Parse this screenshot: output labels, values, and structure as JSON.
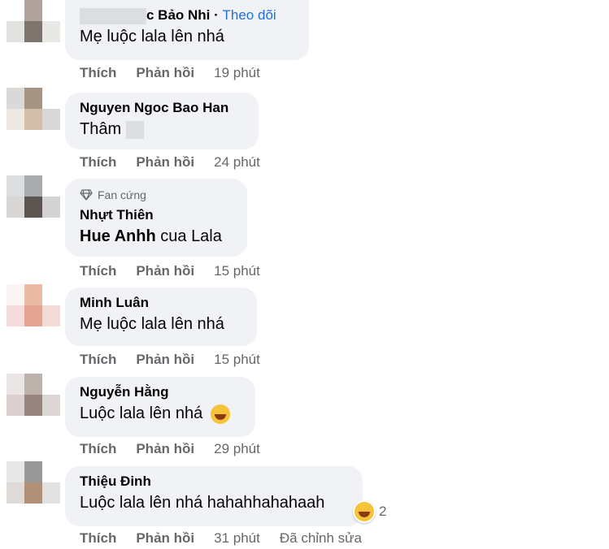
{
  "comments": [
    {
      "name": "c Bảo Nhi",
      "follow": "Theo dõi",
      "text": "Mẹ luộc lala lên nhá",
      "like": "Thích",
      "reply": "Phản hồi",
      "time": "19 phút"
    },
    {
      "name": "Nguyen Ngoc Bao Han",
      "text": "Thâm",
      "like": "Thích",
      "reply": "Phản hồi",
      "time": "24 phút"
    },
    {
      "badge": "Fan cứng",
      "name": "Nhựt Thiên",
      "mention": "Hue Anhh",
      "text": " cua Lala",
      "like": "Thích",
      "reply": "Phản hồi",
      "time": "15 phút"
    },
    {
      "name": "Minh Luân",
      "text": "Mẹ luộc lala lên nhá",
      "like": "Thích",
      "reply": "Phản hồi",
      "time": "15 phút"
    },
    {
      "name": "Nguyễn Hằng",
      "text": "Luộc lala lên nhá",
      "emoji": "laughing-emoji",
      "like": "Thích",
      "reply": "Phản hồi",
      "time": "29 phút"
    },
    {
      "name": "Thiệu Đinh",
      "text": "Luộc lala lên nhá hahahhahahaah",
      "reaction_count": "2",
      "like": "Thích",
      "reply": "Phản hồi",
      "time": "31 phút",
      "edited": "Đã chỉnh sửa"
    }
  ],
  "colors": {
    "bubble": "#f0f2f5",
    "link": "#216fdb",
    "meta": "#65676b"
  }
}
